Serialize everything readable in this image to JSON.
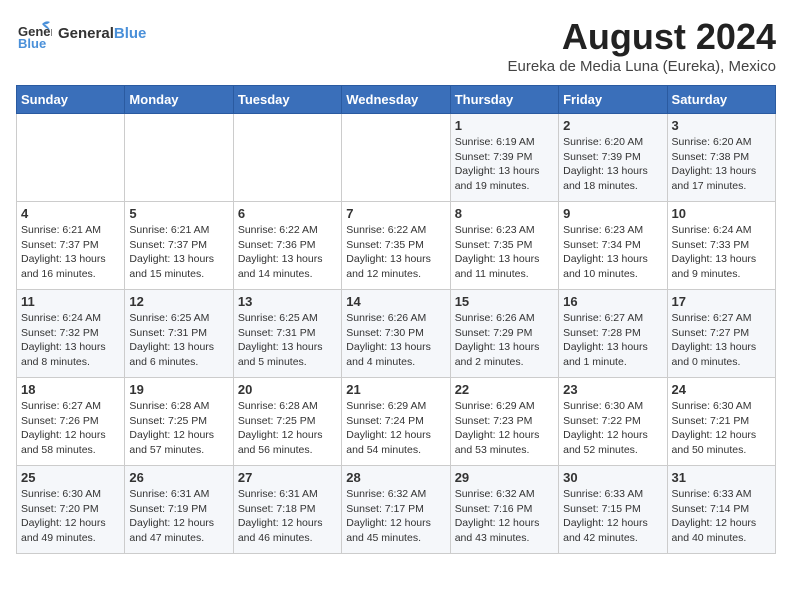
{
  "header": {
    "logo_general": "General",
    "logo_blue": "Blue",
    "title": "August 2024",
    "subtitle": "Eureka de Media Luna (Eureka), Mexico"
  },
  "days_of_week": [
    "Sunday",
    "Monday",
    "Tuesday",
    "Wednesday",
    "Thursday",
    "Friday",
    "Saturday"
  ],
  "weeks": [
    [
      {
        "day": "",
        "info": ""
      },
      {
        "day": "",
        "info": ""
      },
      {
        "day": "",
        "info": ""
      },
      {
        "day": "",
        "info": ""
      },
      {
        "day": "1",
        "info": "Sunrise: 6:19 AM\nSunset: 7:39 PM\nDaylight: 13 hours\nand 19 minutes."
      },
      {
        "day": "2",
        "info": "Sunrise: 6:20 AM\nSunset: 7:39 PM\nDaylight: 13 hours\nand 18 minutes."
      },
      {
        "day": "3",
        "info": "Sunrise: 6:20 AM\nSunset: 7:38 PM\nDaylight: 13 hours\nand 17 minutes."
      }
    ],
    [
      {
        "day": "4",
        "info": "Sunrise: 6:21 AM\nSunset: 7:37 PM\nDaylight: 13 hours\nand 16 minutes."
      },
      {
        "day": "5",
        "info": "Sunrise: 6:21 AM\nSunset: 7:37 PM\nDaylight: 13 hours\nand 15 minutes."
      },
      {
        "day": "6",
        "info": "Sunrise: 6:22 AM\nSunset: 7:36 PM\nDaylight: 13 hours\nand 14 minutes."
      },
      {
        "day": "7",
        "info": "Sunrise: 6:22 AM\nSunset: 7:35 PM\nDaylight: 13 hours\nand 12 minutes."
      },
      {
        "day": "8",
        "info": "Sunrise: 6:23 AM\nSunset: 7:35 PM\nDaylight: 13 hours\nand 11 minutes."
      },
      {
        "day": "9",
        "info": "Sunrise: 6:23 AM\nSunset: 7:34 PM\nDaylight: 13 hours\nand 10 minutes."
      },
      {
        "day": "10",
        "info": "Sunrise: 6:24 AM\nSunset: 7:33 PM\nDaylight: 13 hours\nand 9 minutes."
      }
    ],
    [
      {
        "day": "11",
        "info": "Sunrise: 6:24 AM\nSunset: 7:32 PM\nDaylight: 13 hours\nand 8 minutes."
      },
      {
        "day": "12",
        "info": "Sunrise: 6:25 AM\nSunset: 7:31 PM\nDaylight: 13 hours\nand 6 minutes."
      },
      {
        "day": "13",
        "info": "Sunrise: 6:25 AM\nSunset: 7:31 PM\nDaylight: 13 hours\nand 5 minutes."
      },
      {
        "day": "14",
        "info": "Sunrise: 6:26 AM\nSunset: 7:30 PM\nDaylight: 13 hours\nand 4 minutes."
      },
      {
        "day": "15",
        "info": "Sunrise: 6:26 AM\nSunset: 7:29 PM\nDaylight: 13 hours\nand 2 minutes."
      },
      {
        "day": "16",
        "info": "Sunrise: 6:27 AM\nSunset: 7:28 PM\nDaylight: 13 hours\nand 1 minute."
      },
      {
        "day": "17",
        "info": "Sunrise: 6:27 AM\nSunset: 7:27 PM\nDaylight: 13 hours\nand 0 minutes."
      }
    ],
    [
      {
        "day": "18",
        "info": "Sunrise: 6:27 AM\nSunset: 7:26 PM\nDaylight: 12 hours\nand 58 minutes."
      },
      {
        "day": "19",
        "info": "Sunrise: 6:28 AM\nSunset: 7:25 PM\nDaylight: 12 hours\nand 57 minutes."
      },
      {
        "day": "20",
        "info": "Sunrise: 6:28 AM\nSunset: 7:25 PM\nDaylight: 12 hours\nand 56 minutes."
      },
      {
        "day": "21",
        "info": "Sunrise: 6:29 AM\nSunset: 7:24 PM\nDaylight: 12 hours\nand 54 minutes."
      },
      {
        "day": "22",
        "info": "Sunrise: 6:29 AM\nSunset: 7:23 PM\nDaylight: 12 hours\nand 53 minutes."
      },
      {
        "day": "23",
        "info": "Sunrise: 6:30 AM\nSunset: 7:22 PM\nDaylight: 12 hours\nand 52 minutes."
      },
      {
        "day": "24",
        "info": "Sunrise: 6:30 AM\nSunset: 7:21 PM\nDaylight: 12 hours\nand 50 minutes."
      }
    ],
    [
      {
        "day": "25",
        "info": "Sunrise: 6:30 AM\nSunset: 7:20 PM\nDaylight: 12 hours\nand 49 minutes."
      },
      {
        "day": "26",
        "info": "Sunrise: 6:31 AM\nSunset: 7:19 PM\nDaylight: 12 hours\nand 47 minutes."
      },
      {
        "day": "27",
        "info": "Sunrise: 6:31 AM\nSunset: 7:18 PM\nDaylight: 12 hours\nand 46 minutes."
      },
      {
        "day": "28",
        "info": "Sunrise: 6:32 AM\nSunset: 7:17 PM\nDaylight: 12 hours\nand 45 minutes."
      },
      {
        "day": "29",
        "info": "Sunrise: 6:32 AM\nSunset: 7:16 PM\nDaylight: 12 hours\nand 43 minutes."
      },
      {
        "day": "30",
        "info": "Sunrise: 6:33 AM\nSunset: 7:15 PM\nDaylight: 12 hours\nand 42 minutes."
      },
      {
        "day": "31",
        "info": "Sunrise: 6:33 AM\nSunset: 7:14 PM\nDaylight: 12 hours\nand 40 minutes."
      }
    ]
  ]
}
